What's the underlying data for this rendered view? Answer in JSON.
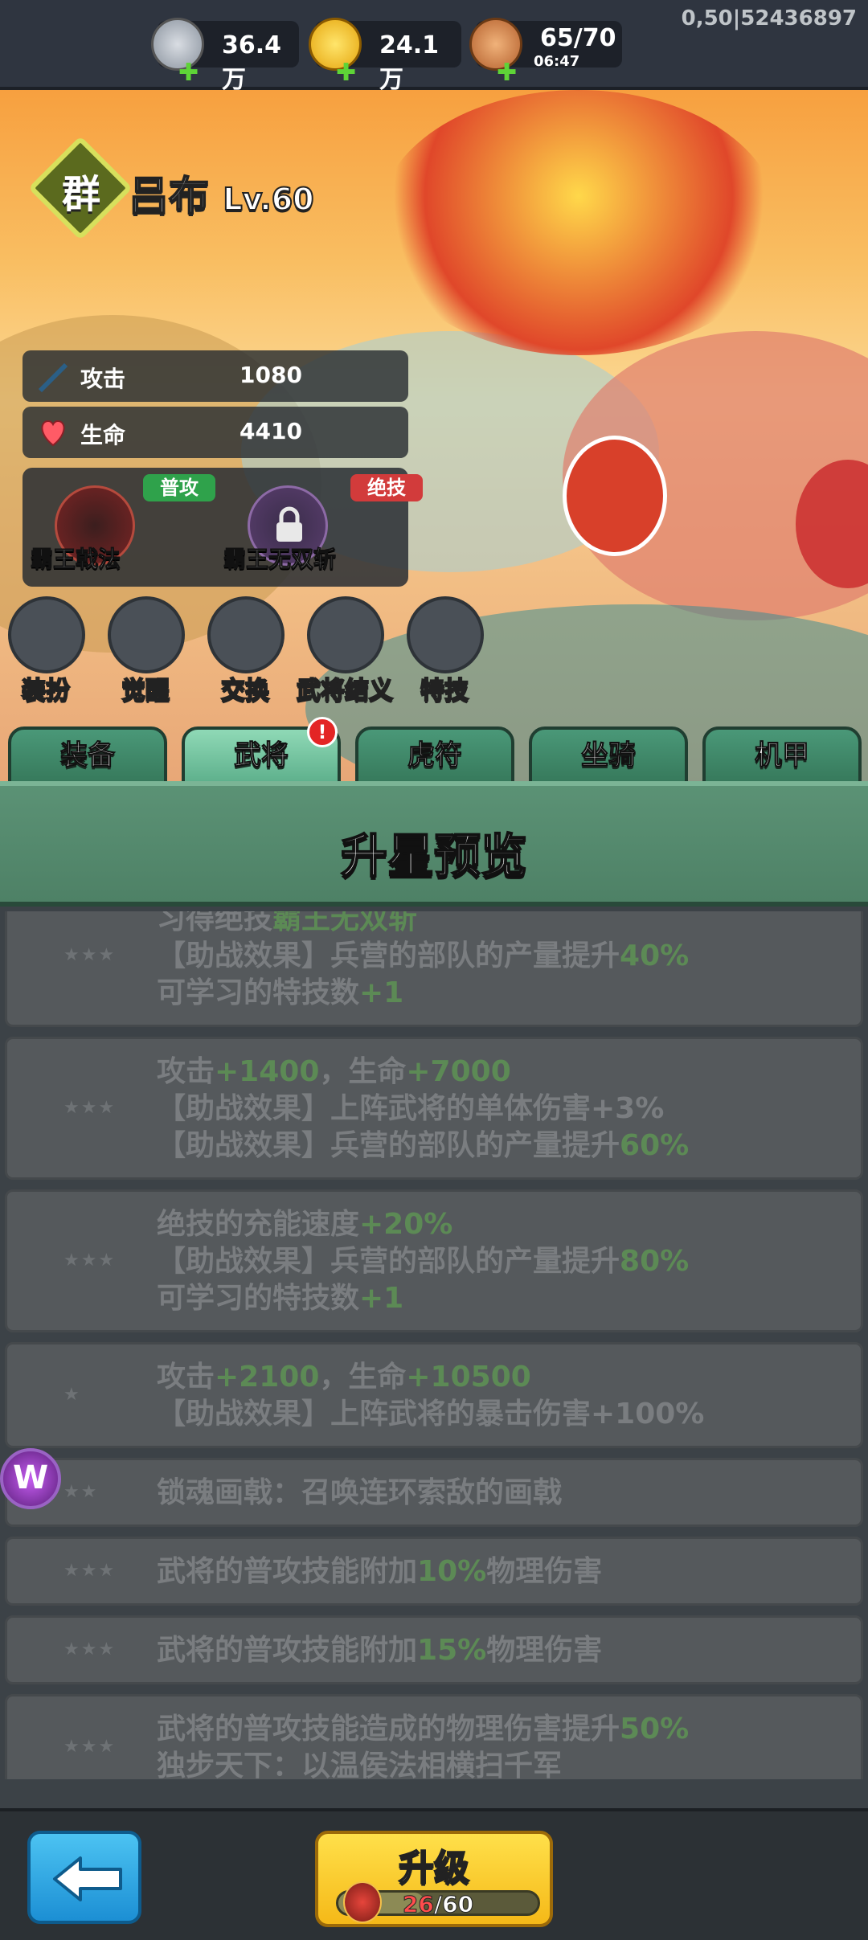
{
  "topbar": {
    "silver": "36.4万",
    "gold": "24.1万",
    "stamina": "65/70",
    "stamina_timer": "06:47",
    "coord_text": "0,50|52436897"
  },
  "hero": {
    "faction": "群",
    "name": "吕布",
    "level": "Lv.60"
  },
  "stats": [
    {
      "label": "攻击",
      "value": "1080"
    },
    {
      "label": "生命",
      "value": "4410"
    }
  ],
  "skills": [
    {
      "tag": "普攻",
      "name": "霸王戟法"
    },
    {
      "tag": "绝技",
      "name": "霸王无双斩"
    }
  ],
  "actions": [
    "装扮",
    "觉醒",
    "交换",
    "武将结义",
    "特技"
  ],
  "tabs": [
    "装备",
    "武将",
    "虎符",
    "坐骑",
    "机甲"
  ],
  "tab_badge": "!",
  "panel_title": "升星预览",
  "star_rows": [
    {
      "stars": "★★★",
      "lines": [
        [
          "习得绝技",
          "霸王无双斩"
        ],
        [
          "【助战效果】兵营的部队的产量提升",
          "40%"
        ],
        [
          "可学习的特技数",
          "+1"
        ]
      ]
    },
    {
      "stars": "★★★",
      "lines": [
        [
          "攻击",
          "+1400",
          "，生命",
          "+7000"
        ],
        [
          "【助战效果】上阵武将的单体伤害+3%"
        ],
        [
          "【助战效果】兵营的部队的产量提升",
          "60%"
        ]
      ]
    },
    {
      "stars": "★★★",
      "lines": [
        [
          "绝技的充能速度",
          "+20%"
        ],
        [
          "【助战效果】兵营的部队的产量提升",
          "80%"
        ],
        [
          "可学习的特技数",
          "+1"
        ]
      ]
    },
    {
      "stars": "★",
      "lines": [
        [
          "攻击",
          "+2100",
          "，生命",
          "+10500"
        ],
        [
          "【助战效果】上阵武将的暴击伤害+100%"
        ]
      ]
    },
    {
      "stars": "★★",
      "lines": [
        [
          "锁魂画戟：召唤连环索敌的画戟"
        ]
      ]
    },
    {
      "stars": "★★★",
      "lines": [
        [
          "武将的普攻技能附加",
          "10%",
          "物理伤害"
        ]
      ]
    },
    {
      "stars": "★★★",
      "lines": [
        [
          "武将的普攻技能附加",
          "15%",
          "物理伤害"
        ]
      ]
    },
    {
      "stars": "★★★",
      "lines": [
        [
          "武将的普攻技能造成的物理伤害提升",
          "50%"
        ],
        [
          "独步天下：以温侯法相横扫千军"
        ]
      ]
    }
  ],
  "upgrade": {
    "label": "升级",
    "current": "26",
    "total": "/60",
    "progress": 0.43
  },
  "colors": {
    "accent_green": "#4e8166",
    "upgrade_gold": "#f5b918",
    "back_blue": "#1c8fd4"
  }
}
